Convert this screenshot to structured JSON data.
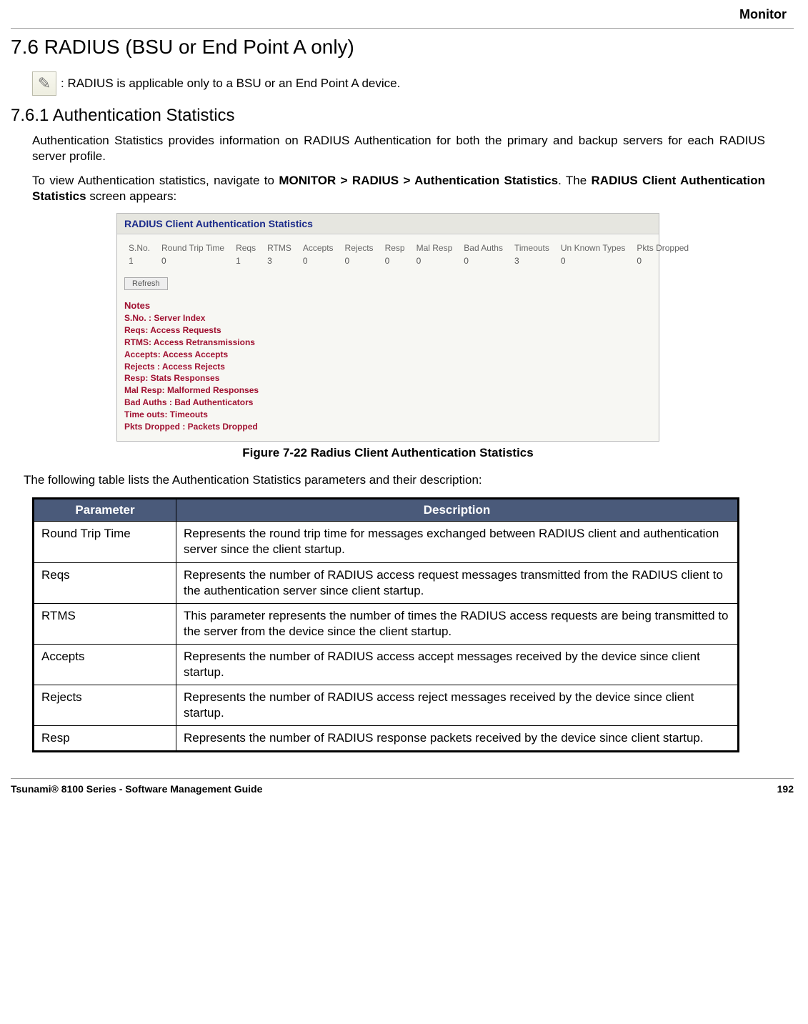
{
  "header": {
    "label": "Monitor"
  },
  "section": {
    "title": "7.6 RADIUS (BSU or End Point A only)"
  },
  "note": {
    "text": ": RADIUS is applicable only to a BSU or an End Point A device."
  },
  "subsection": {
    "title": "7.6.1 Authentication Statistics"
  },
  "para1": "Authentication Statistics provides information on RADIUS Authentication for both the primary and backup servers for each RADIUS server profile.",
  "para2_pre": "To view Authentication statistics, navigate to ",
  "para2_nav": "MONITOR > RADIUS > Authentication Statistics",
  "para2_mid": ". The ",
  "para2_screen": "RADIUS Client Authentication Statistics",
  "para2_post": " screen appears:",
  "screenshot": {
    "title": "RADIUS Client Authentication Statistics",
    "headers": [
      "S.No.",
      "Round Trip Time",
      "Reqs",
      "RTMS",
      "Accepts",
      "Rejects",
      "Resp",
      "Mal Resp",
      "Bad Auths",
      "Timeouts",
      "Un Known Types",
      "Pkts Dropped"
    ],
    "row": [
      "1",
      "0",
      "1",
      "3",
      "0",
      "0",
      "0",
      "0",
      "0",
      "3",
      "0",
      "0"
    ],
    "refresh": "Refresh",
    "notes_heading": "Notes",
    "notes": [
      "S.No. : Server Index",
      "Reqs: Access Requests",
      "RTMS: Access Retransmissions",
      "Accepts: Access Accepts",
      "Rejects : Access Rejects",
      "Resp: Stats Responses",
      "Mal Resp: Malformed Responses",
      "Bad Auths : Bad Authenticators",
      "Time outs: Timeouts",
      "Pkts Dropped : Packets Dropped"
    ]
  },
  "figure_caption": "Figure 7-22 Radius Client Authentication Statistics",
  "param_intro": "The following table lists the Authentication Statistics parameters and their description:",
  "param_table": {
    "headers": [
      "Parameter",
      "Description"
    ],
    "rows": [
      {
        "p": "Round Trip Time",
        "d": "Represents the round trip time for messages exchanged between RADIUS client and authentication server since the client startup."
      },
      {
        "p": "Reqs",
        "d": "Represents the number of RADIUS access request messages transmitted from the RADIUS client to the authentication server since client startup."
      },
      {
        "p": "RTMS",
        "d": "This parameter represents the number of times the RADIUS access requests are being transmitted to the server from the device since the client startup."
      },
      {
        "p": "Accepts",
        "d": "Represents the number of RADIUS access accept messages received by the device since client startup."
      },
      {
        "p": "Rejects",
        "d": "Represents the number of RADIUS access reject messages received by the device since client startup."
      },
      {
        "p": "Resp",
        "d": "Represents the number of RADIUS response packets received by the device since client startup."
      }
    ]
  },
  "footer": {
    "left": "Tsunami® 8100 Series - Software Management Guide",
    "right": "192"
  }
}
